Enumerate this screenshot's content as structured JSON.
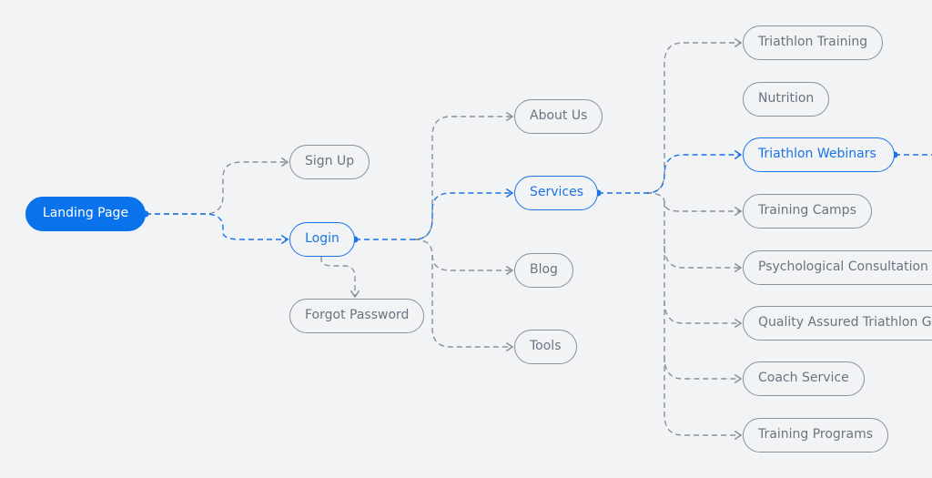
{
  "colors": {
    "accent": "#1a73e8",
    "accent_fill": "#0a72ea",
    "connector": "#8a919c",
    "text": "#6b7280",
    "background": "#f2f3f5"
  },
  "nodes": {
    "landing_page": "Landing Page",
    "sign_up": "Sign Up",
    "login": "Login",
    "forgot_password": "Forgot Password",
    "about_us": "About Us",
    "services": "Services",
    "blog": "Blog",
    "tools": "Tools",
    "triathlon_training": "Triathlon Training",
    "nutrition": "Nutrition",
    "triathlon_webinars": "Triathlon Webinars",
    "training_camps": "Training Camps",
    "psychological_consultation": "Psychological Consultation",
    "quality_assured": "Quality Assured Triathlon G",
    "coach_service": "Coach Service",
    "training_programs": "Training Programs"
  }
}
